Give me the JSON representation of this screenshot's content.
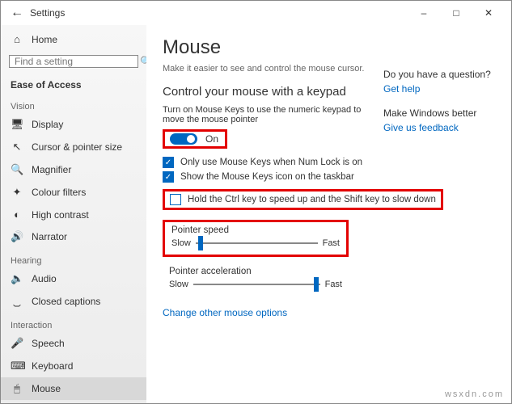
{
  "window": {
    "title": "Settings"
  },
  "sidebar": {
    "home": "Home",
    "search_placeholder": "Find a setting",
    "category": "Ease of Access",
    "groups": {
      "vision": {
        "label": "Vision",
        "items": [
          "Display",
          "Cursor & pointer size",
          "Magnifier",
          "Colour filters",
          "High contrast",
          "Narrator"
        ]
      },
      "hearing": {
        "label": "Hearing",
        "items": [
          "Audio",
          "Closed captions"
        ]
      },
      "interaction": {
        "label": "Interaction",
        "items": [
          "Speech",
          "Keyboard",
          "Mouse"
        ]
      }
    }
  },
  "main": {
    "title": "Mouse",
    "subtitle": "Make it easier to see and control the mouse cursor.",
    "section_title": "Control your mouse with a keypad",
    "toggle_desc": "Turn on Mouse Keys to use the numeric keypad to move the mouse pointer",
    "toggle_state": "On",
    "cb1": "Only use Mouse Keys when Num Lock is on",
    "cb2": "Show the Mouse Keys icon on the taskbar",
    "cb3": "Hold the Ctrl key to speed up and the Shift key to slow down",
    "pointer_speed": {
      "title": "Pointer speed",
      "low": "Slow",
      "high": "Fast"
    },
    "pointer_accel": {
      "title": "Pointer acceleration",
      "low": "Slow",
      "high": "Fast"
    },
    "link": "Change other mouse options"
  },
  "right": {
    "question": "Do you have a question?",
    "gethelp": "Get help",
    "better": "Make Windows better",
    "feedback": "Give us feedback"
  },
  "watermark": "wsxdn.com"
}
